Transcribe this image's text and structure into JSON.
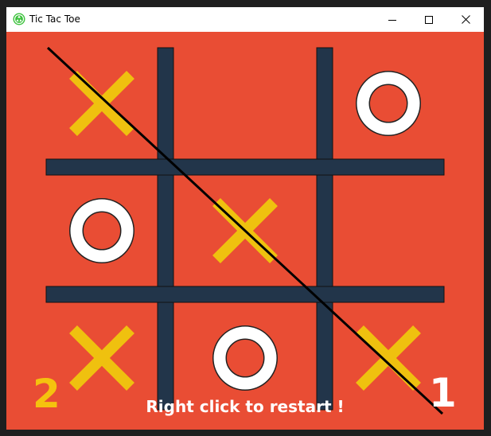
{
  "window": {
    "title": "Tic Tac Toe",
    "app_icon": "recycle-icon",
    "controls": [
      "minimize-icon",
      "maximize-icon",
      "close-icon"
    ]
  },
  "colors": {
    "background": "#e94d34",
    "grid": "#22354a",
    "x_mark": "#efc10f",
    "o_mark": "#ffffff",
    "win_line": "#000000"
  },
  "board": {
    "rows": [
      [
        "X",
        "",
        "O"
      ],
      [
        "O",
        "X",
        ""
      ],
      [
        "X",
        "O",
        "X"
      ]
    ],
    "winning_line": "diagonal-top-left-to-bottom-right"
  },
  "scores": {
    "left": "2",
    "right": "1"
  },
  "status_text": "Right click to restart !"
}
